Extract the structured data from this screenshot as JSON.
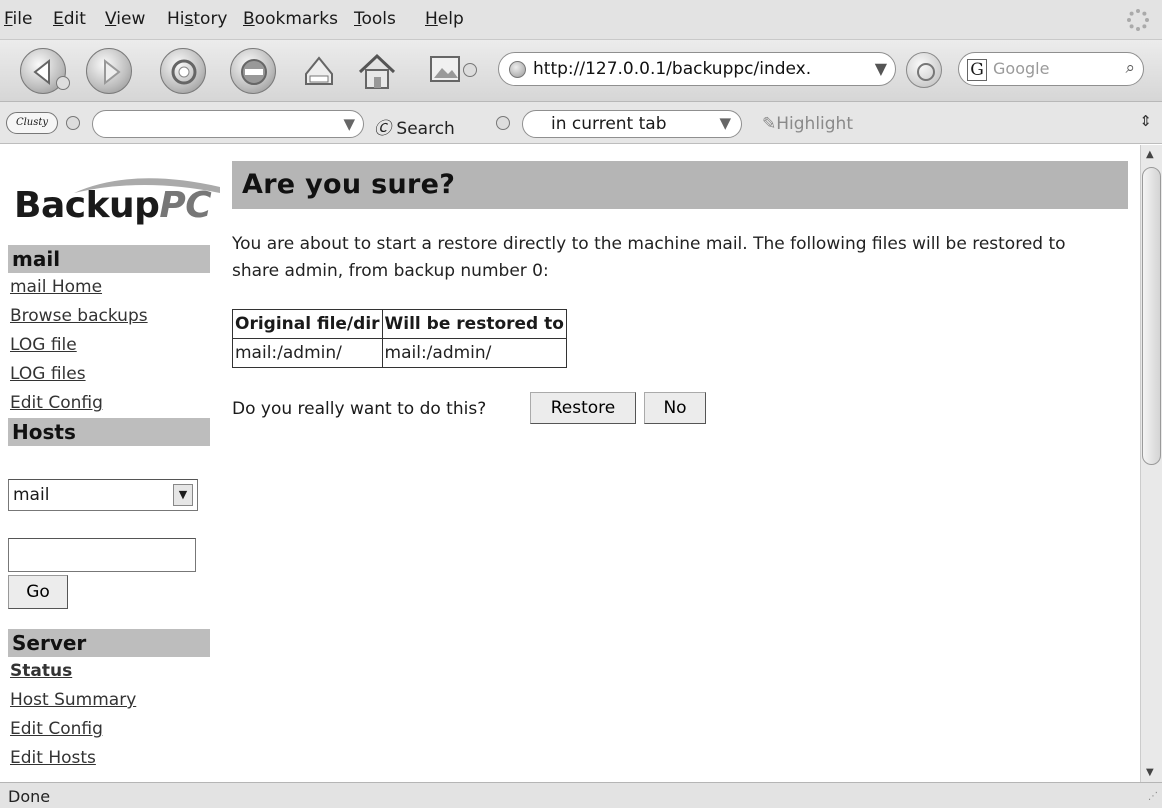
{
  "menu": {
    "items": [
      {
        "label": "File",
        "u": "F",
        "rest": "ile"
      },
      {
        "label": "Edit",
        "u": "E",
        "rest": "dit"
      },
      {
        "label": "View",
        "u": "V",
        "rest": "iew"
      },
      {
        "label": "History",
        "pre": "Hi",
        "u": "s",
        "rest": "tory"
      },
      {
        "label": "Bookmarks",
        "u": "B",
        "rest": "ookmarks"
      },
      {
        "label": "Tools",
        "u": "T",
        "rest": "ools"
      },
      {
        "label": "Help",
        "u": "H",
        "rest": "elp"
      }
    ]
  },
  "navbar": {
    "url": "http://127.0.0.1/backuppc/index.",
    "search_placeholder": "Google",
    "search_engine_letter": "G"
  },
  "toolbar3": {
    "clusty_label": "Clusty",
    "search_label": "Search",
    "tab_option": "in current tab",
    "highlight_label": "Highlight"
  },
  "logo": {
    "main": "Backup",
    "suffix": "PC"
  },
  "sidebar": {
    "host_section_title": "mail",
    "host_links": [
      "mail Home",
      "Browse backups",
      "LOG file",
      "LOG files",
      "Edit Config"
    ],
    "hosts_title": "Hosts",
    "host_select_value": "mail",
    "host_input_value": "",
    "go_label": "Go",
    "server_title": "Server",
    "server_links": [
      "Status",
      "Host Summary",
      "Edit Config",
      "Edit Hosts"
    ]
  },
  "main": {
    "title": "Are you sure?",
    "message": "You are about to start a restore directly to the machine mail. The following files will be restored to share admin, from backup number 0:",
    "table": {
      "headers": [
        "Original file/dir",
        "Will be restored to"
      ],
      "rows": [
        [
          "mail:/admin/",
          "mail:/admin/"
        ]
      ]
    },
    "confirm_question": "Do you really want to do this?",
    "restore_label": "Restore",
    "no_label": "No"
  },
  "status": {
    "text": "Done"
  }
}
